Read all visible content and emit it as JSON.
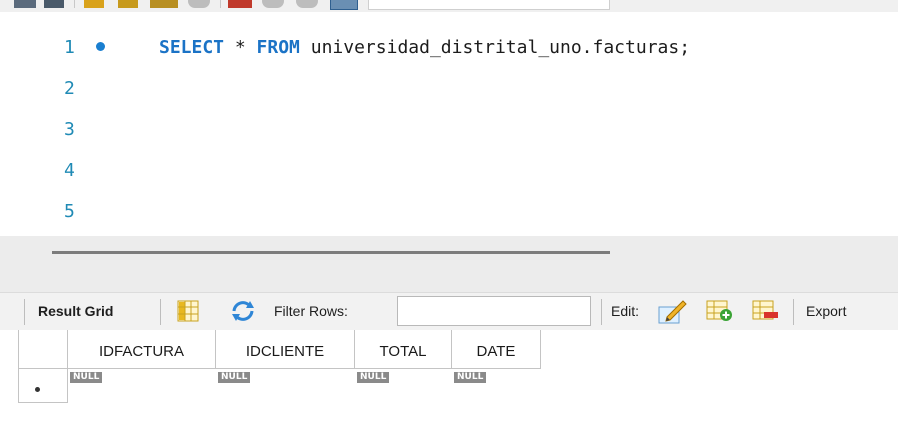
{
  "editor": {
    "line_numbers": [
      "1",
      "2",
      "3",
      "4",
      "5"
    ],
    "query": {
      "keyword_select": "SELECT",
      "star": " * ",
      "keyword_from": "FROM",
      "rest": " universidad_distrital_uno.facturas;"
    }
  },
  "result_toolbar": {
    "result_grid_label": "Result Grid",
    "filter_label": "Filter Rows:",
    "filter_value": "",
    "edit_label": "Edit:",
    "export_label": "Export"
  },
  "grid": {
    "columns": [
      "IDFACTURA",
      "IDCLIENTE",
      "TOTAL",
      "DATE"
    ],
    "row": [
      "NULL",
      "NULL",
      "NULL",
      "NULL"
    ]
  },
  "icons": {
    "grid_view": "grid-layout-icon",
    "refresh": "refresh-arrows-icon",
    "edit": "pencil-edit-icon",
    "add_row": "add-row-icon",
    "delete_row": "delete-row-icon"
  }
}
